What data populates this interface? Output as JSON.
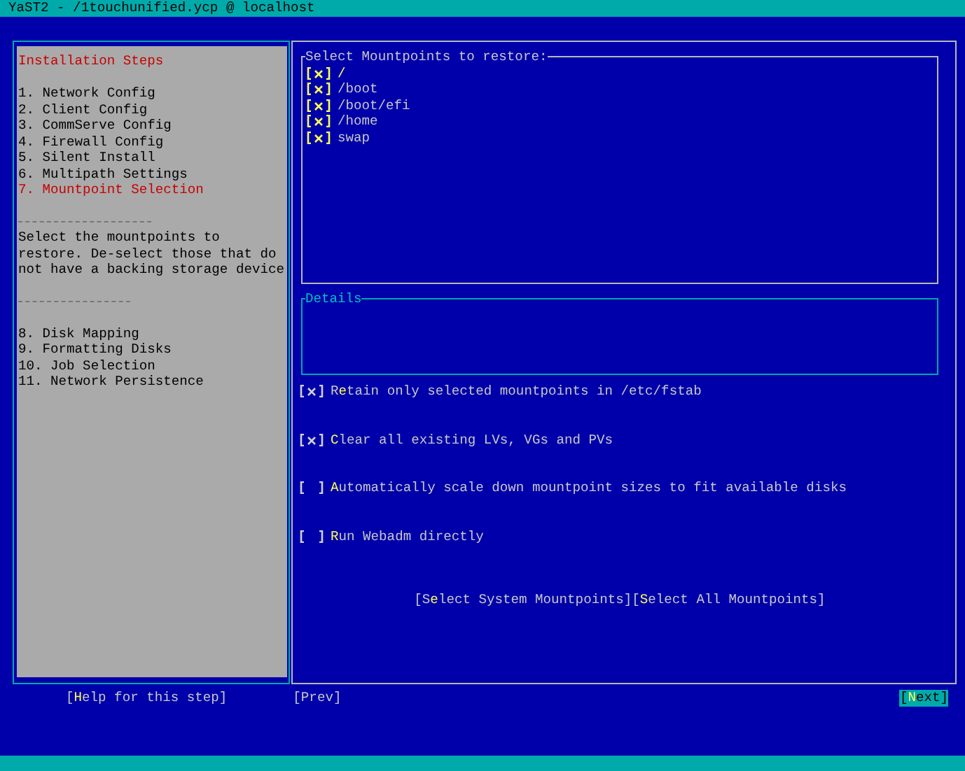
{
  "window": {
    "title": "YaST2 - /1touchunified.ycp @ localhost"
  },
  "steps_panel": {
    "heading": "Installation Steps",
    "steps_before": [
      {
        "label": "1. Network Config",
        "current": false
      },
      {
        "label": "2. Client Config",
        "current": false
      },
      {
        "label": "3. CommServe Config",
        "current": false
      },
      {
        "label": "4. Firewall Config",
        "current": false
      },
      {
        "label": "5. Silent Install",
        "current": false
      },
      {
        "label": "6. Multipath Settings",
        "current": false
      },
      {
        "label": "7. Mountpoint Selection",
        "current": true
      }
    ],
    "help_text": "Select the mountpoints to restore. De-select those that do not have a backing storage device",
    "steps_after": [
      {
        "label": "8. Disk Mapping",
        "current": false
      },
      {
        "label": "9. Formatting Disks",
        "current": false
      },
      {
        "label": "10. Job Selection",
        "current": false
      },
      {
        "label": "11. Network Persistence",
        "current": false
      }
    ]
  },
  "mountpoints": {
    "title": "Select Mountpoints to restore:",
    "items": [
      {
        "label": "/",
        "checked": true,
        "selected": true
      },
      {
        "label": "/boot",
        "checked": true,
        "selected": false
      },
      {
        "label": "/boot/efi",
        "checked": true,
        "selected": false
      },
      {
        "label": "/home",
        "checked": true,
        "selected": false
      },
      {
        "label": "swap",
        "checked": true,
        "selected": false
      }
    ]
  },
  "details": {
    "title": "Details"
  },
  "options": [
    {
      "label": "R**e**tain only selected mountpoints in /etc/fstab",
      "checked": true
    },
    {
      "label": "**C**lear all existing LVs, VGs and PVs",
      "checked": true
    },
    {
      "label": "**A**utomatically scale down mountpoint sizes to fit available disks",
      "checked": false
    },
    {
      "label": "**R**un Webadm directly",
      "checked": false
    }
  ],
  "select_buttons": [
    {
      "label": "[S**e**lect System Mountpoints]"
    },
    {
      "label": "[**S**elect All Mountpoints]"
    }
  ],
  "footer_buttons": [
    {
      "label": "[**H**elp for this step]",
      "focused": false
    },
    {
      "label": "[Prev]",
      "focused": false
    },
    {
      "label": "[**N**ext]",
      "focused": true
    }
  ]
}
